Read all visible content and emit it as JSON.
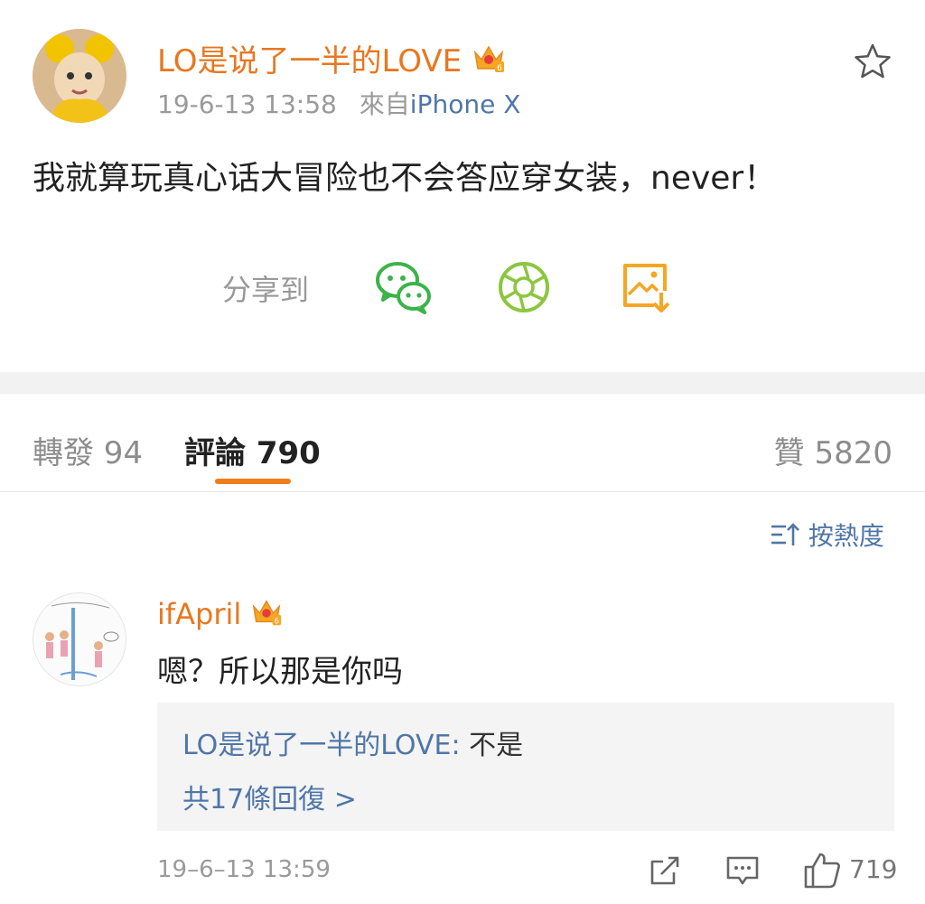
{
  "post": {
    "author": "LO是说了一半的LOVE",
    "time": "19-6-13 13:58",
    "source_prefix": "來自",
    "source": "iPhone X",
    "text": "我就算玩真心话大冒险也不会答应穿女装，never！",
    "badge_level": "6"
  },
  "share": {
    "label": "分享到",
    "icons": [
      "wechat-icon",
      "moments-icon",
      "save-image-icon"
    ]
  },
  "tabs": {
    "repost": "轉發 94",
    "comments": "評論 790",
    "likes": "贊 5820"
  },
  "sort": {
    "label": "按熱度"
  },
  "comment": {
    "author": "ifApril",
    "badge_level": "6",
    "text": "嗯？所以那是你吗",
    "reply_user": "LO是说了一半的LOVE",
    "reply_sep": ": ",
    "reply_text": "不是",
    "more_replies": "共17條回復 >",
    "time": "19–6–13 13:59",
    "like_count": "719"
  },
  "colors": {
    "accent_orange": "#e8771f",
    "link_blue": "#4f76a8",
    "wechat_green": "#3bb34a",
    "moments_green": "#8cc63f",
    "save_orange": "#f5a623"
  }
}
